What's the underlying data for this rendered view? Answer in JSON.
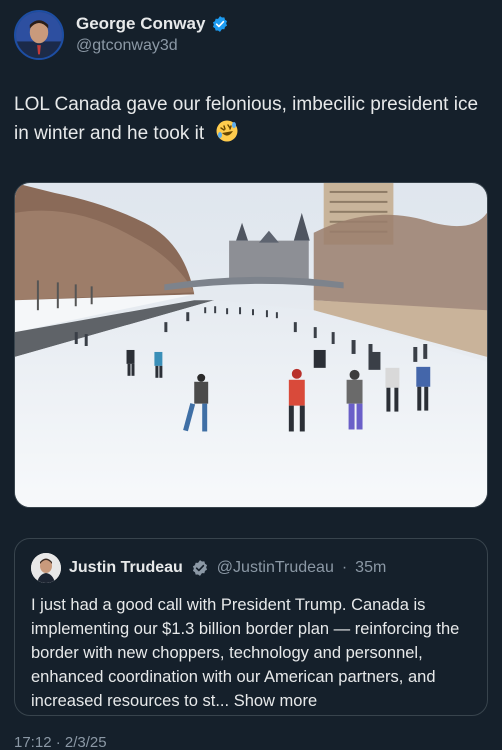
{
  "author": {
    "display_name": "George Conway",
    "handle": "@gtconway3d",
    "verified": true,
    "avatar_icon": "profile-photo-icon"
  },
  "tweet": {
    "text": "LOL Canada gave our felonious, imbecilic president ice in winter and he took it",
    "emoji": "rolling-on-floor-laughing-emoji"
  },
  "photo": {
    "icon": "photo-skaters-on-frozen-canal"
  },
  "quote": {
    "display_name": "Justin Trudeau",
    "handle": "@JustinTrudeau",
    "separator": "·",
    "time": "35m",
    "text": "I just had a good call with President Trump. Canada is implementing our $1.3 billion border plan — reinforcing the border with new choppers, technology and personnel, enhanced coordination with our American partners, and increased resources to st...",
    "show_more": "Show more"
  },
  "timestamp": "17:12 · 2/3/25",
  "colors": {
    "background": "#15202b",
    "text": "#e7e9ea",
    "muted": "#8b98a5",
    "verified": "#1d9bf0",
    "border": "#38444d"
  }
}
